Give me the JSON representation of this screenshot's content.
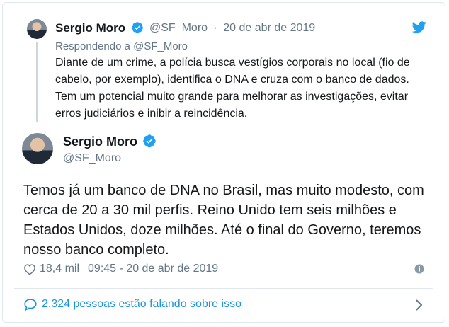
{
  "quoted_tweet": {
    "name": "Sergio Moro",
    "handle": "@SF_Moro",
    "separator": "·",
    "date": "20 de abr de 2019",
    "replying_to": "Respondendo a @SF_Moro",
    "text": "Diante de um crime, a polícia busca vestígios corporais no local (fio de cabelo, por exemplo), identifica o DNA e cruza com o banco de dados. Tem um potencial muito grande para melhorar as investigações, evitar erros judiciários e inibir a reincidência."
  },
  "main_tweet": {
    "name": "Sergio Moro",
    "handle": "@SF_Moro",
    "text": "Temos já um banco de DNA no Brasil, mas muito modesto, com cerca de 20 a 30 mil perfis. Reino Unido tem seis milhões e Estados Unidos, doze milhões. Até o final do Governo, teremos nosso banco completo.",
    "likes": "18,4 mil",
    "timestamp": "09:45 - 20 de abr de 2019"
  },
  "footer": {
    "talking_label": "2.324 pessoas estão falando sobre isso"
  },
  "icons": {
    "verified": "verified-badge-icon",
    "twitter": "twitter-bird-icon",
    "heart": "heart-icon",
    "info": "info-icon",
    "comment": "comment-bubble-icon",
    "chevron": "chevron-right-icon"
  },
  "colors": {
    "brand_blue": "#1da1f2",
    "link_blue": "#1b95e0",
    "muted_text": "#657786",
    "main_text": "#14171a",
    "border": "#e1e8ed"
  }
}
